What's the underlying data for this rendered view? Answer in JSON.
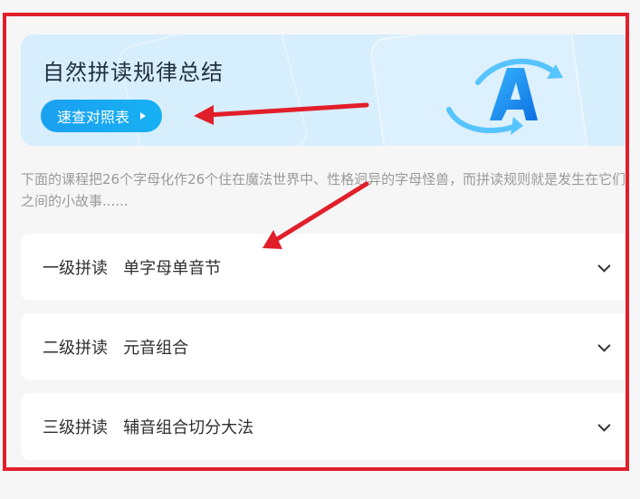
{
  "banner": {
    "title": "自然拼读规律总结",
    "button_label": "速查对照表"
  },
  "description": "下面的课程把26个字母化作26个住在魔法世界中、性格迥异的字母怪兽，而拼读规则就是发生在它们之间的小故事......",
  "levels": [
    {
      "label": "一级拼读   单字母单音节"
    },
    {
      "label": "二级拼读   元音组合"
    },
    {
      "label": "三级拼读   辅音组合切分大法"
    }
  ],
  "colors": {
    "accent": "#1aa0f0",
    "banner_bg": "#d7eefd",
    "annotation": "#e11f2a"
  },
  "icons": {
    "banner_icon": "letter-a-rotate-icon",
    "play": "play-icon",
    "chevron": "chevron-down-icon"
  }
}
